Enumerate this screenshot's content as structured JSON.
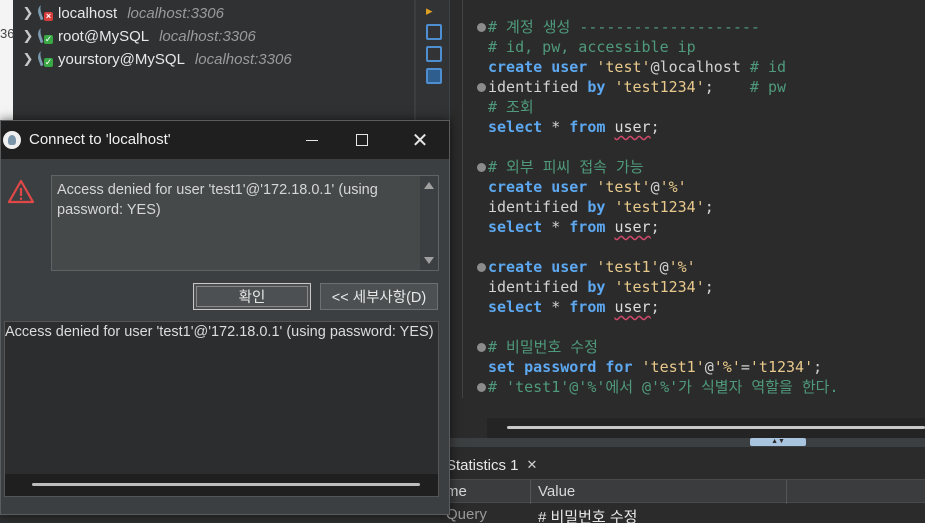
{
  "navigator": {
    "edge_text": "36",
    "connections": [
      {
        "name": "localhost",
        "host": "localhost:3306",
        "status": "error"
      },
      {
        "name": "root@MySQL",
        "host": "localhost:3306",
        "status": "ok"
      },
      {
        "name": "yourstory@MySQL",
        "host": "localhost:3306",
        "status": "ok"
      }
    ]
  },
  "editor": {
    "lines": [
      {
        "fold": true,
        "parts": [
          [
            "cm",
            "# 계정 생성 --------------------"
          ]
        ]
      },
      {
        "fold": false,
        "parts": [
          [
            "cm",
            "# id, pw, accessible ip"
          ]
        ]
      },
      {
        "fold": false,
        "parts": [
          [
            "kw",
            "create user "
          ],
          [
            "st",
            "'test'"
          ],
          [
            "id",
            "@localhost "
          ],
          [
            "cm",
            "# id"
          ]
        ]
      },
      {
        "fold": true,
        "parts": [
          [
            "id",
            "identified "
          ],
          [
            "kw",
            "by "
          ],
          [
            "st",
            "'test1234'"
          ],
          [
            "id",
            ";    "
          ],
          [
            "cm",
            "# pw"
          ]
        ]
      },
      {
        "fold": false,
        "parts": [
          [
            "cm",
            "# 조회"
          ]
        ]
      },
      {
        "fold": false,
        "parts": [
          [
            "kw",
            "select "
          ],
          [
            "id",
            "* "
          ],
          [
            "kw",
            "from "
          ],
          [
            "ul",
            "user"
          ],
          [
            "id",
            ";"
          ]
        ]
      },
      {
        "fold": false,
        "parts": []
      },
      {
        "fold": true,
        "parts": [
          [
            "cm",
            "# 외부 피씨 접속 가능"
          ]
        ]
      },
      {
        "fold": false,
        "parts": [
          [
            "kw",
            "create user "
          ],
          [
            "st",
            "'test'"
          ],
          [
            "id",
            "@"
          ],
          [
            "st",
            "'%'"
          ]
        ]
      },
      {
        "fold": false,
        "parts": [
          [
            "id",
            "identified "
          ],
          [
            "kw",
            "by "
          ],
          [
            "st",
            "'test1234'"
          ],
          [
            "id",
            ";"
          ]
        ]
      },
      {
        "fold": false,
        "parts": [
          [
            "kw",
            "select "
          ],
          [
            "id",
            "* "
          ],
          [
            "kw",
            "from "
          ],
          [
            "ul",
            "user"
          ],
          [
            "id",
            ";"
          ]
        ]
      },
      {
        "fold": false,
        "parts": []
      },
      {
        "fold": true,
        "parts": [
          [
            "kw",
            "create user "
          ],
          [
            "st",
            "'test1'"
          ],
          [
            "id",
            "@"
          ],
          [
            "st",
            "'%'"
          ]
        ]
      },
      {
        "fold": false,
        "parts": [
          [
            "id",
            "identified "
          ],
          [
            "kw",
            "by "
          ],
          [
            "st",
            "'test1234'"
          ],
          [
            "id",
            ";"
          ]
        ]
      },
      {
        "fold": false,
        "parts": [
          [
            "kw",
            "select "
          ],
          [
            "id",
            "* "
          ],
          [
            "kw",
            "from "
          ],
          [
            "ul",
            "user"
          ],
          [
            "id",
            ";"
          ]
        ]
      },
      {
        "fold": false,
        "parts": []
      },
      {
        "fold": true,
        "parts": [
          [
            "cm",
            "# 비밀번호 수정"
          ]
        ]
      },
      {
        "fold": false,
        "parts": [
          [
            "kw",
            "set password for "
          ],
          [
            "st",
            "'test1'"
          ],
          [
            "id",
            "@"
          ],
          [
            "st",
            "'%'"
          ],
          [
            "id",
            "="
          ],
          [
            "st",
            "'t1234'"
          ],
          [
            "id",
            ";"
          ]
        ]
      },
      {
        "fold": true,
        "parts": [
          [
            "cm",
            "# 'test1'@'%'에서 @'%'가 식별자 역할을 한다."
          ]
        ]
      }
    ]
  },
  "results": {
    "tab_label": "Statistics 1",
    "columns": [
      "me",
      "Value"
    ],
    "rows": [
      [
        "Query",
        "# 비밀번호 수정"
      ]
    ]
  },
  "dialog": {
    "title": "Connect to 'localhost'",
    "message": "Access denied for user 'test1'@'172.18.0.1' (using password: YES)",
    "ok_label": "확인",
    "details_label": "<< 세부사항(D)",
    "details_text": "Access denied for user 'test1'@'172.18.0.1' (using password: YES)"
  },
  "colors": {
    "keyword": "#5da8f0",
    "string": "#e8c98b",
    "comment": "#4f9a7c",
    "error": "#d63d3d"
  }
}
